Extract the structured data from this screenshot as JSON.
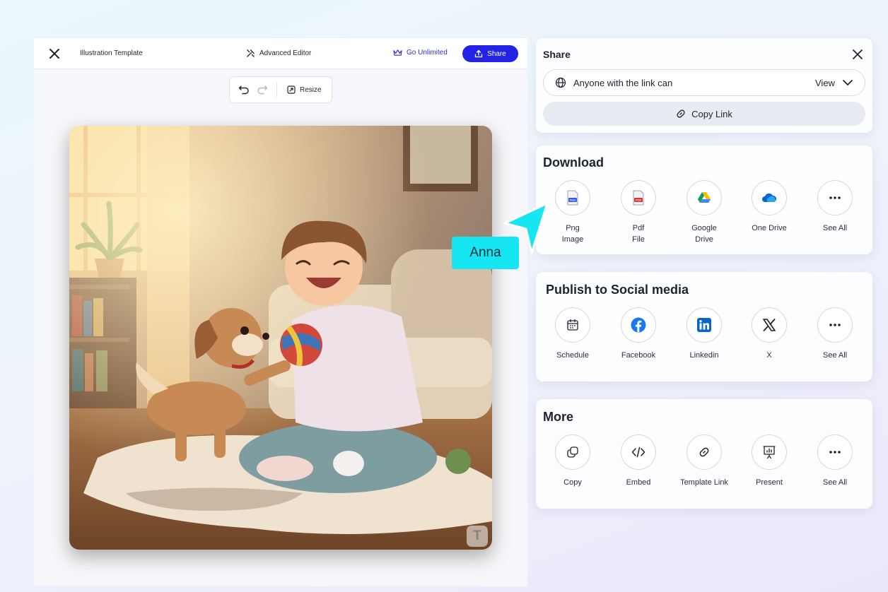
{
  "editor": {
    "template_name": "Illustration Template",
    "advanced_editor": "Advanced Editor",
    "go_unlimited": "Go Unlimited",
    "share": "Share",
    "resize": "Resize",
    "watermark": "T"
  },
  "share_panel": {
    "title": "Share",
    "permission_text": "Anyone with the link can",
    "permission_value": "View",
    "copy_link": "Copy Link"
  },
  "download": {
    "title": "Download",
    "items": [
      {
        "label": "Png\nImage",
        "icon": "png-file-icon"
      },
      {
        "label": "Pdf\nFile",
        "icon": "pdf-file-icon"
      },
      {
        "label": "Google\nDrive",
        "icon": "google-drive-icon"
      },
      {
        "label": "One Drive",
        "icon": "onedrive-icon"
      },
      {
        "label": "See All",
        "icon": "more-icon"
      }
    ]
  },
  "social": {
    "title": "Publish to Social media",
    "items": [
      {
        "label": "Schedule",
        "icon": "calendar-icon"
      },
      {
        "label": "Facebook",
        "icon": "facebook-icon"
      },
      {
        "label": "Linkedin",
        "icon": "linkedin-icon"
      },
      {
        "label": "X",
        "icon": "x-icon"
      },
      {
        "label": "See All",
        "icon": "more-icon"
      }
    ]
  },
  "more": {
    "title": "More",
    "items": [
      {
        "label": "Copy",
        "icon": "copy-icon"
      },
      {
        "label": "Embed",
        "icon": "code-icon"
      },
      {
        "label": "Template Link",
        "icon": "link-icon"
      },
      {
        "label": "Present",
        "icon": "presentation-icon"
      },
      {
        "label": "See All",
        "icon": "more-icon"
      }
    ]
  },
  "collaborator": {
    "name": "Anna",
    "color": "#15e6f2"
  },
  "colors": {
    "primary": "#2323e6",
    "accent_text": "#2a2fd6"
  }
}
